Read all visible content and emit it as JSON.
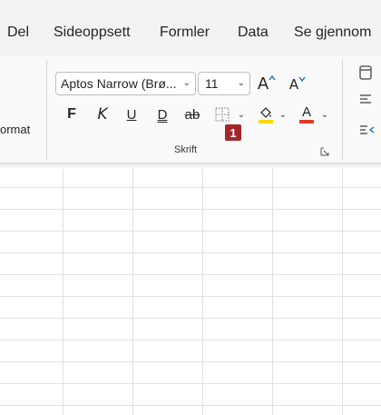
{
  "menu": {
    "tabs": [
      {
        "label": "Del"
      },
      {
        "label": "Sideoppsett"
      },
      {
        "label": "Formler"
      },
      {
        "label": "Data"
      },
      {
        "label": "Se gjennom"
      }
    ]
  },
  "ribbon": {
    "left_cut_label": "ormat",
    "font_name": "Aptos Narrow (Brø...",
    "font_size": "11",
    "grow_font_label": "A",
    "shrink_font_label": "A",
    "bold_label": "F",
    "italic_label": "K",
    "underline_label": "U",
    "double_underline_label": "D",
    "strikethrough_label": "ab",
    "font_color_letter": "A",
    "group_label": "Skrift",
    "step_badge": "1",
    "colors": {
      "fill_color": "#ffd700",
      "font_color": "#e23b24",
      "accent_arrow": "#0f6cbd"
    }
  }
}
